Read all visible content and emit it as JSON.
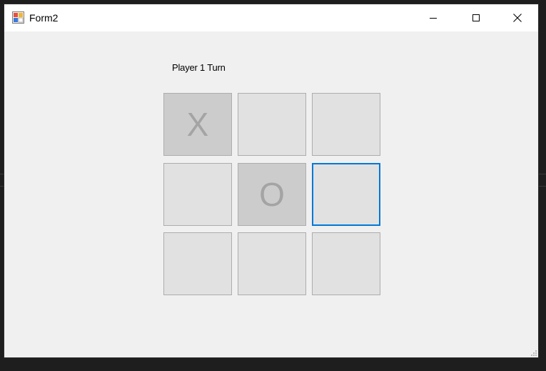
{
  "window": {
    "title": "Form2",
    "icon": "winforms-app-icon",
    "controls": {
      "minimize_icon": "minimize-icon",
      "maximize_icon": "maximize-icon",
      "close_icon": "close-icon"
    }
  },
  "game": {
    "turn_label": "Player 1 Turn",
    "board": [
      [
        "X",
        "",
        ""
      ],
      [
        "",
        "O",
        ""
      ],
      [
        "",
        "",
        ""
      ]
    ],
    "played_cells": [
      [
        0,
        0
      ],
      [
        1,
        1
      ]
    ],
    "focused_cell": [
      1,
      2
    ]
  },
  "colors": {
    "cell_background": "#e1e1e1",
    "played_cell_background": "#cccccc",
    "mark_color": "#a4a4a4",
    "focus_border": "#0078d7",
    "window_background": "#f0f0f0"
  }
}
